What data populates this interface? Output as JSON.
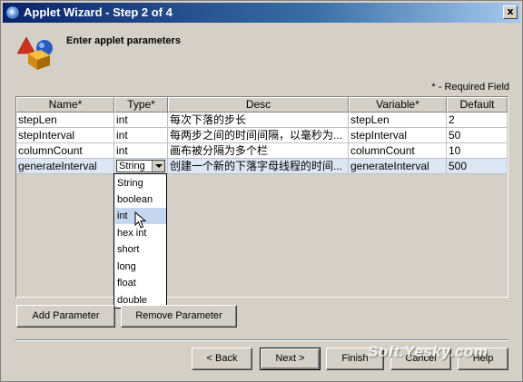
{
  "window": {
    "title": "Applet Wizard - Step 2 of 4",
    "close_label": "x"
  },
  "heading": "Enter applet parameters",
  "required_note": "* - Required Field",
  "table": {
    "columns": [
      "Name*",
      "Type*",
      "Desc",
      "Variable*",
      "Default"
    ],
    "rows": [
      {
        "name": "stepLen",
        "type": "int",
        "desc": "每次下落的步长",
        "variable": "stepLen",
        "default": "2"
      },
      {
        "name": "stepInterval",
        "type": "int",
        "desc": "每两步之间的时间间隔，以毫秒为...",
        "variable": "stepInterval",
        "default": "50"
      },
      {
        "name": "columnCount",
        "type": "int",
        "desc": "画布被分隔为多个栏",
        "variable": "columnCount",
        "default": "10"
      },
      {
        "name": "generateInterval",
        "type": "String",
        "desc": "创建一个新的下落字母线程的时间...",
        "variable": "generateInterval",
        "default": "500"
      }
    ]
  },
  "type_dropdown": {
    "options": [
      "String",
      "boolean",
      "int",
      "hex int",
      "short",
      "long",
      "float",
      "double"
    ],
    "highlighted": "int"
  },
  "buttons": {
    "add_parameter": "Add Parameter",
    "remove_parameter": "Remove Parameter",
    "back": "< Back",
    "next": "Next >",
    "finish": "Finish",
    "cancel": "Cancel",
    "help": "Help"
  },
  "watermark": "Soft.Yesky.com"
}
